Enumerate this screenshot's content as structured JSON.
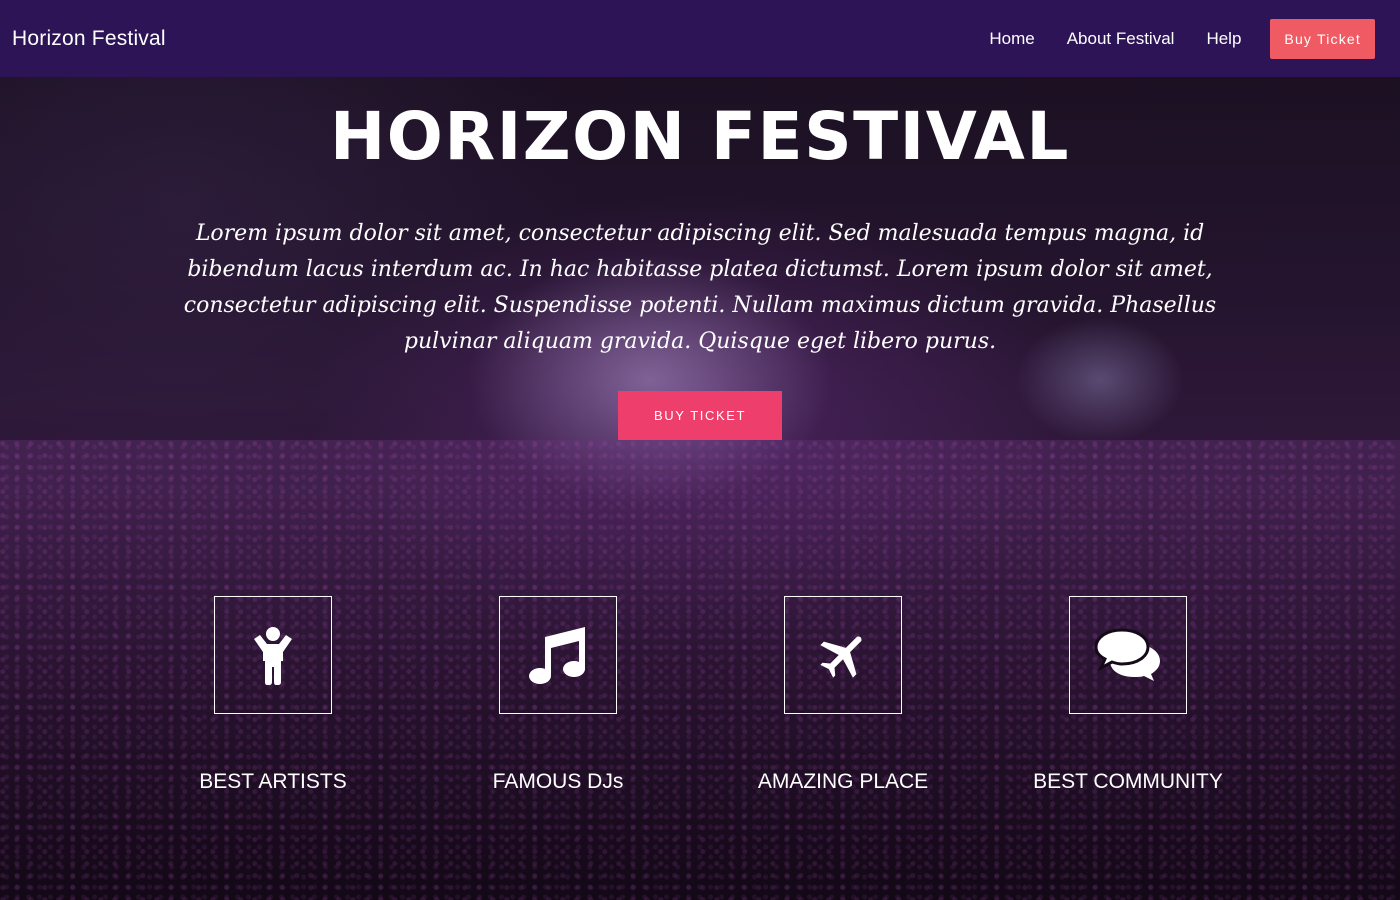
{
  "navbar": {
    "brand": "Horizon Festival",
    "links": [
      "Home",
      "About Festival",
      "Help"
    ],
    "cta": "Buy Ticket"
  },
  "hero": {
    "title": "HORIZON FESTIVAL",
    "text": "Lorem ipsum dolor sit amet, consectetur adipiscing elit. Sed malesuada tempus magna, id bibendum lacus interdum ac. In hac habitasse platea dictumst. Lorem ipsum dolor sit amet, consectetur adipiscing elit. Suspendisse potenti. Nullam maximus dictum gravida. Phasellus pulvinar aliquam gravida. Quisque eget libero purus.",
    "button": "BUY TICKET"
  },
  "features": [
    {
      "label": "BEST ARTISTS",
      "icon": "child-icon"
    },
    {
      "label": "FAMOUS DJs",
      "icon": "music-note-icon"
    },
    {
      "label": "AMAZING PLACE",
      "icon": "plane-icon"
    },
    {
      "label": "BEST COMMUNITY",
      "icon": "chat-bubbles-icon"
    }
  ],
  "colors": {
    "navbar": "#2d1457",
    "nav_button": "#ef5a63",
    "hero_button": "#ee3f6c"
  }
}
